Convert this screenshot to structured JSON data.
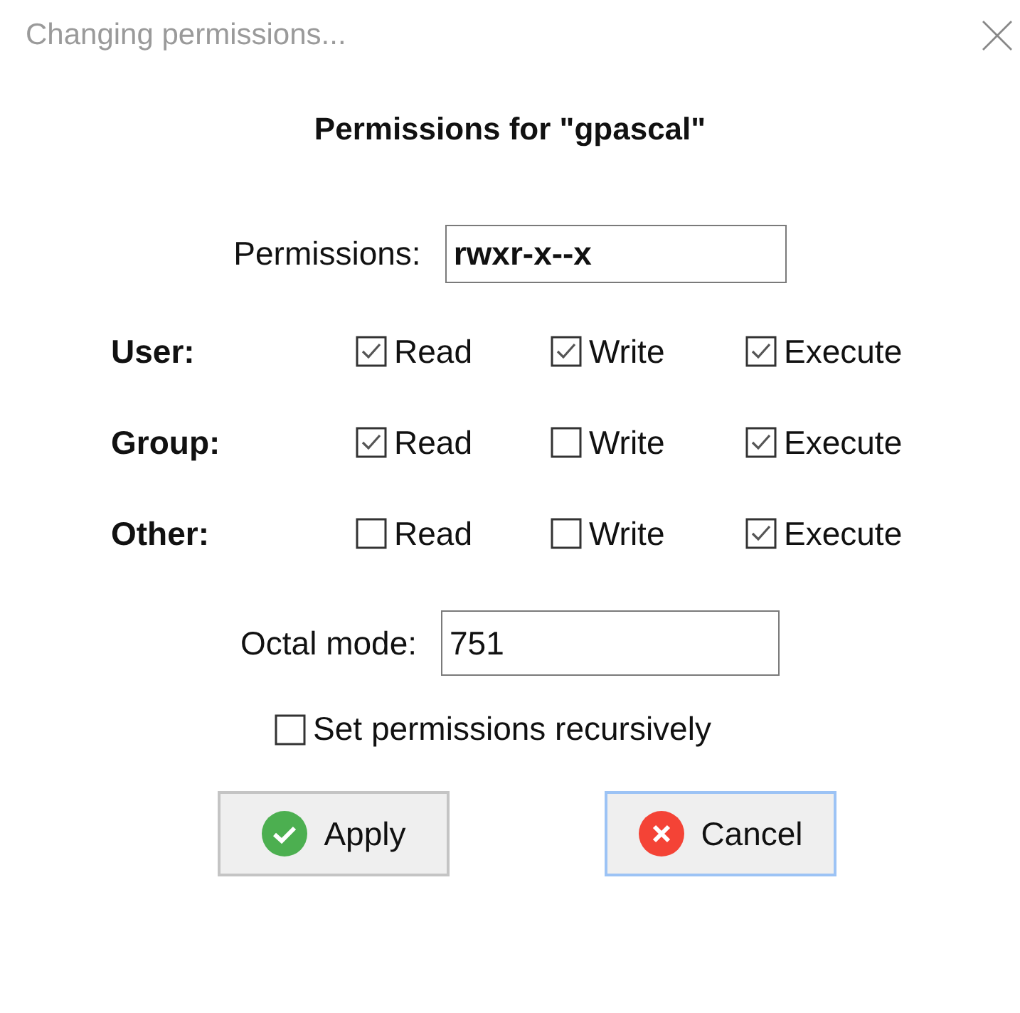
{
  "window": {
    "title": "Changing permissions..."
  },
  "heading": "Permissions for \"gpascal\"",
  "permissions_field": {
    "label": "Permissions:",
    "value": "rwxr-x--x"
  },
  "rows": [
    {
      "label": "User:",
      "options": [
        {
          "label": "Read",
          "checked": true
        },
        {
          "label": "Write",
          "checked": true
        },
        {
          "label": "Execute",
          "checked": true
        }
      ]
    },
    {
      "label": "Group:",
      "options": [
        {
          "label": "Read",
          "checked": true
        },
        {
          "label": "Write",
          "checked": false
        },
        {
          "label": "Execute",
          "checked": true
        }
      ]
    },
    {
      "label": "Other:",
      "options": [
        {
          "label": "Read",
          "checked": false
        },
        {
          "label": "Write",
          "checked": false
        },
        {
          "label": "Execute",
          "checked": true
        }
      ]
    }
  ],
  "octal_field": {
    "label": "Octal mode:",
    "value": "751"
  },
  "recursive": {
    "label": "Set permissions recursively",
    "checked": false
  },
  "buttons": [
    {
      "kind": "apply",
      "label": "Apply",
      "focused": false
    },
    {
      "kind": "cancel",
      "label": "Cancel",
      "focused": true
    }
  ]
}
